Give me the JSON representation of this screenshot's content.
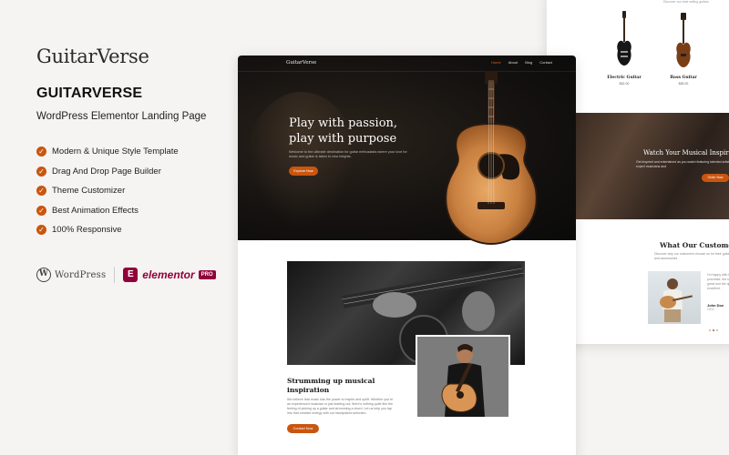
{
  "left_panel": {
    "logo": "GuitarVerse",
    "product_title": "GUITARVERSE",
    "subtitle": "WordPress Elementor Landing Page",
    "features": [
      "Modern & Unique Style Template",
      "Drag And Drop Page Builder",
      "Theme Customizer",
      "Best Animation Effects",
      "100% Responsive"
    ],
    "wordpress_label": "WordPress",
    "elementor_label": "elementor",
    "pro_label": "PRO"
  },
  "mockup": {
    "brand": "GuitarVerse",
    "nav": [
      "Home",
      "About",
      "Blog",
      "Contact"
    ],
    "hero": {
      "title": "Play with passion, play with purpose",
      "description": "Welcome to the ultimate destination for guitar enthusiasts where your love for music and guitar is taken to new heights.",
      "button": "Explore Now"
    },
    "section": {
      "title": "Strumming up musical inspiration",
      "description": "We believe that music has the power to inspire and uplift. Whether you're an experienced musician or just starting out, there's nothing quite like the feeling of picking up a guitar and strumming a chord. Let us help you tap into that creative energy with our handpicked selection.",
      "button": "Contact Now"
    }
  },
  "mockup2": {
    "top_text": "Discover our best selling guitars",
    "products": [
      {
        "name": "Electric Guitar",
        "price": "$62.00"
      },
      {
        "name": "Bass Guitar",
        "price": "$65.00"
      }
    ],
    "banner": {
      "title": "Watch Your Musical Inspiration",
      "description": "Get inspired and entertained as you watch featuring talented artists expert musicians and",
      "button": "Order Now"
    },
    "testimonials": {
      "title": "What Our Customer Say",
      "description": "Discover why our customers choose us for their guitars and accessories",
      "quote": "I'm happy with the purchase, the sound is great and the quality is excellent.",
      "name": "John Doe",
      "role": "CEO"
    }
  },
  "colors": {
    "accent": "#c9560f",
    "hero_bg": "#0f0d0b",
    "elementor": "#92003b"
  }
}
